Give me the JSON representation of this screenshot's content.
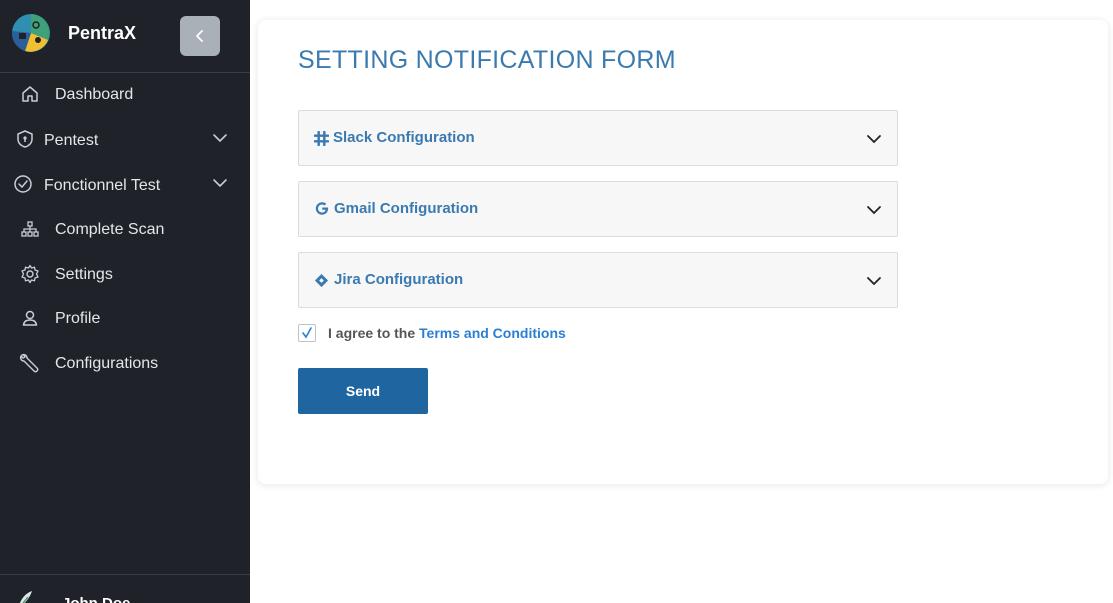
{
  "app": {
    "name": "PentraX"
  },
  "sidebar": {
    "collapse_icon": "chevron-left-icon",
    "items": [
      {
        "label": "Dashboard",
        "icon": "home-icon",
        "expandable": false
      },
      {
        "label": "Pentest",
        "icon": "shield-icon",
        "expandable": true
      },
      {
        "label": "Fonctionnel Test",
        "icon": "check-circle-icon",
        "expandable": true
      },
      {
        "label": "Complete Scan",
        "icon": "sitemap-icon",
        "expandable": false
      },
      {
        "label": "Settings",
        "icon": "gear-icon",
        "expandable": false
      },
      {
        "label": "Profile",
        "icon": "user-icon",
        "expandable": false
      },
      {
        "label": "Configurations",
        "icon": "wrench-icon",
        "expandable": false
      }
    ],
    "user": {
      "name": "John Doe"
    }
  },
  "main": {
    "title": "SETTING NOTIFICATION FORM",
    "accordions": [
      {
        "label": "Slack Configuration",
        "icon": "slack-icon"
      },
      {
        "label": "Gmail Configuration",
        "icon": "google-icon"
      },
      {
        "label": "Jira Configuration",
        "icon": "jira-icon"
      }
    ],
    "agree": {
      "checked": true,
      "prefix": "I agree to the ",
      "link": "Terms and Conditions"
    },
    "send_label": "Send"
  },
  "colors": {
    "sidebar_bg": "#1f2228",
    "accent": "#3a7ab0",
    "button": "#1f66a0",
    "link": "#2a7fd4"
  }
}
